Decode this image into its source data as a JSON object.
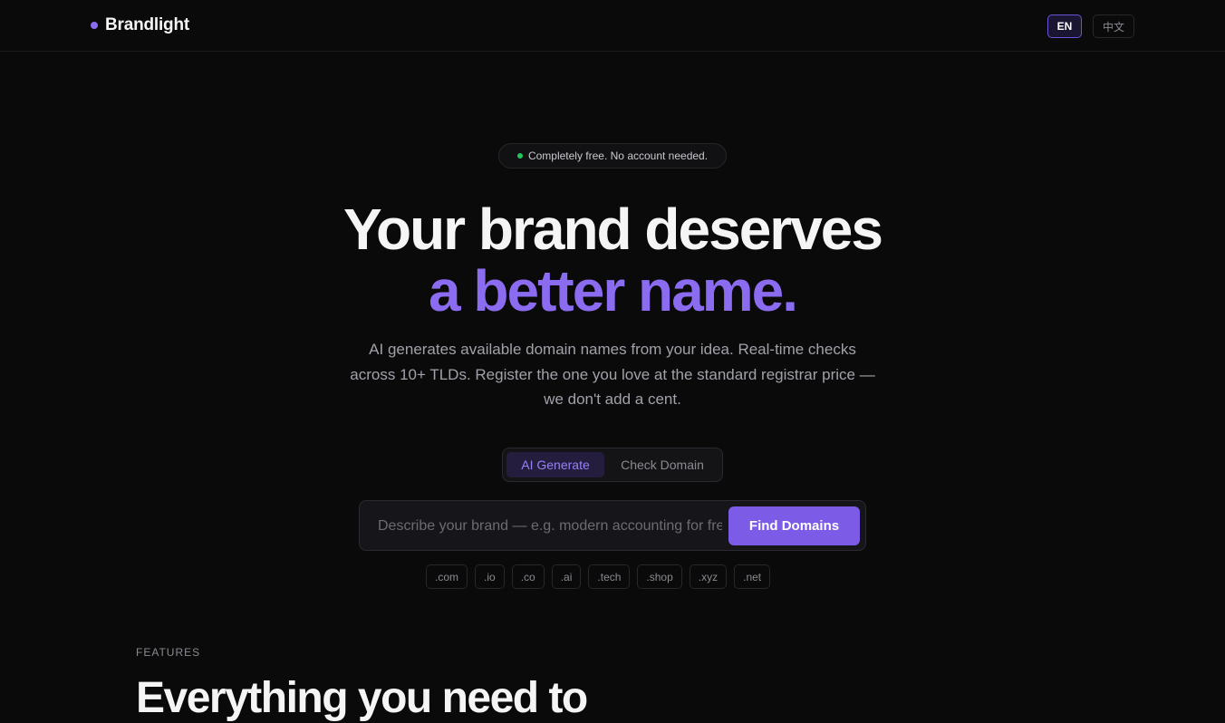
{
  "header": {
    "brand": "Brandlight",
    "lang_en": "EN",
    "lang_zh": "中文"
  },
  "hero": {
    "badge": "Completely free. No account needed.",
    "title_line1": "Your brand deserves",
    "title_line2": "a better name.",
    "subtitle": "AI generates available domain names from your idea. Real-time checks across 10+ TLDs. Register the one you love at the standard registrar price — we don't add a cent."
  },
  "mode_tabs": [
    {
      "label": "AI Generate",
      "active": true
    },
    {
      "label": "Check Domain",
      "active": false
    }
  ],
  "search": {
    "placeholder": "Describe your brand — e.g. modern accounting for freelancers",
    "value": "",
    "button_label": "Find Domains"
  },
  "tlds": [
    ".com",
    ".io",
    ".co",
    ".ai",
    ".tech",
    ".shop",
    ".xyz",
    ".net"
  ],
  "features": {
    "label": "FEATURES",
    "title": "Everything you need to"
  },
  "colors": {
    "accent": "#7c5ce6",
    "background": "#0a0a0b",
    "status_green": "#22c55e"
  }
}
